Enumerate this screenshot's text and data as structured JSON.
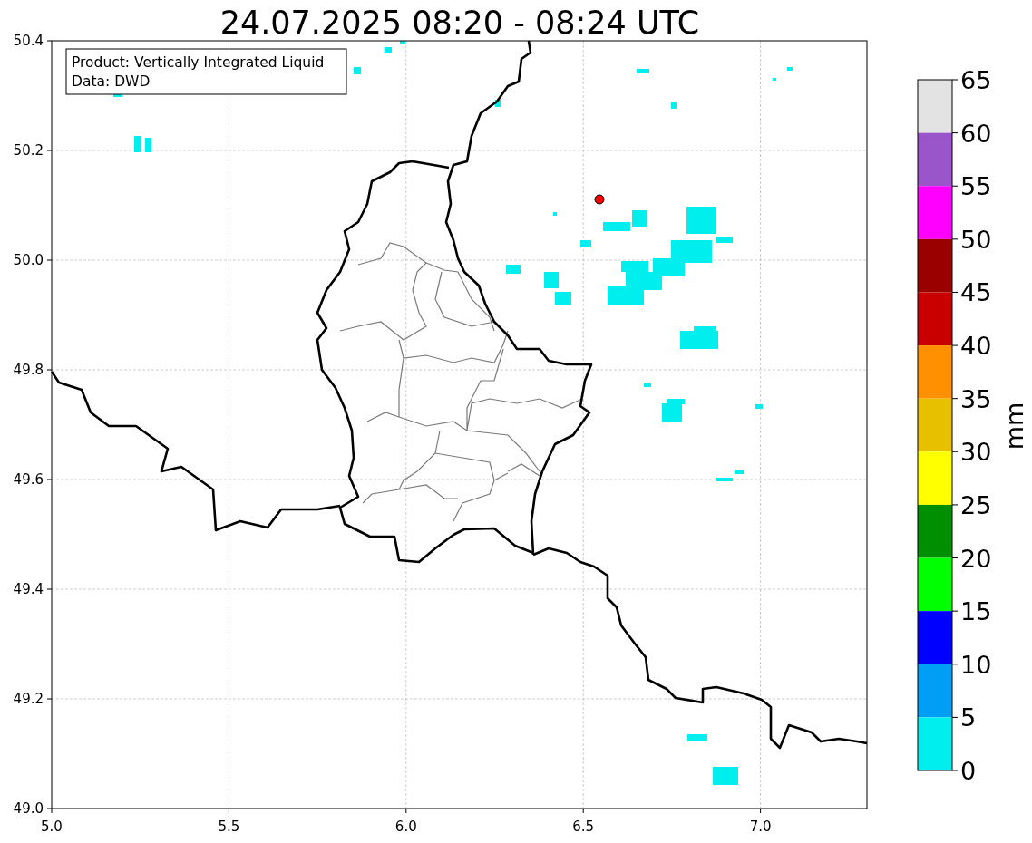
{
  "title": "24.07.2025 08:20 - 08:24 UTC",
  "info_box": {
    "lines": [
      "Product: Vertically Integrated Liquid",
      "Data: DWD"
    ]
  },
  "map": {
    "xticks": [
      "5.0",
      "5.5",
      "6.0",
      "6.5",
      "7.0"
    ],
    "yticks": [
      "50.4",
      "50.2",
      "50.0",
      "49.8",
      "49.6",
      "49.4",
      "49.2",
      "49.0"
    ]
  },
  "colorbar": {
    "label": "mm",
    "ticks": [
      "65",
      "60",
      "55",
      "50",
      "45",
      "40",
      "35",
      "30",
      "25",
      "20",
      "15",
      "10",
      "5",
      "0"
    ],
    "bins": [
      {
        "color": "#e3e3e3"
      },
      {
        "color": "#9955c9"
      },
      {
        "color": "#ff00ff"
      },
      {
        "color": "#9a0000"
      },
      {
        "color": "#c80000"
      },
      {
        "color": "#ff9000"
      },
      {
        "color": "#e7c000"
      },
      {
        "color": "#ffff00"
      },
      {
        "color": "#008f00"
      },
      {
        "color": "#00ff00"
      },
      {
        "color": "#0000ff"
      },
      {
        "color": "#009ff5"
      },
      {
        "color": "#00eeee"
      }
    ]
  }
}
